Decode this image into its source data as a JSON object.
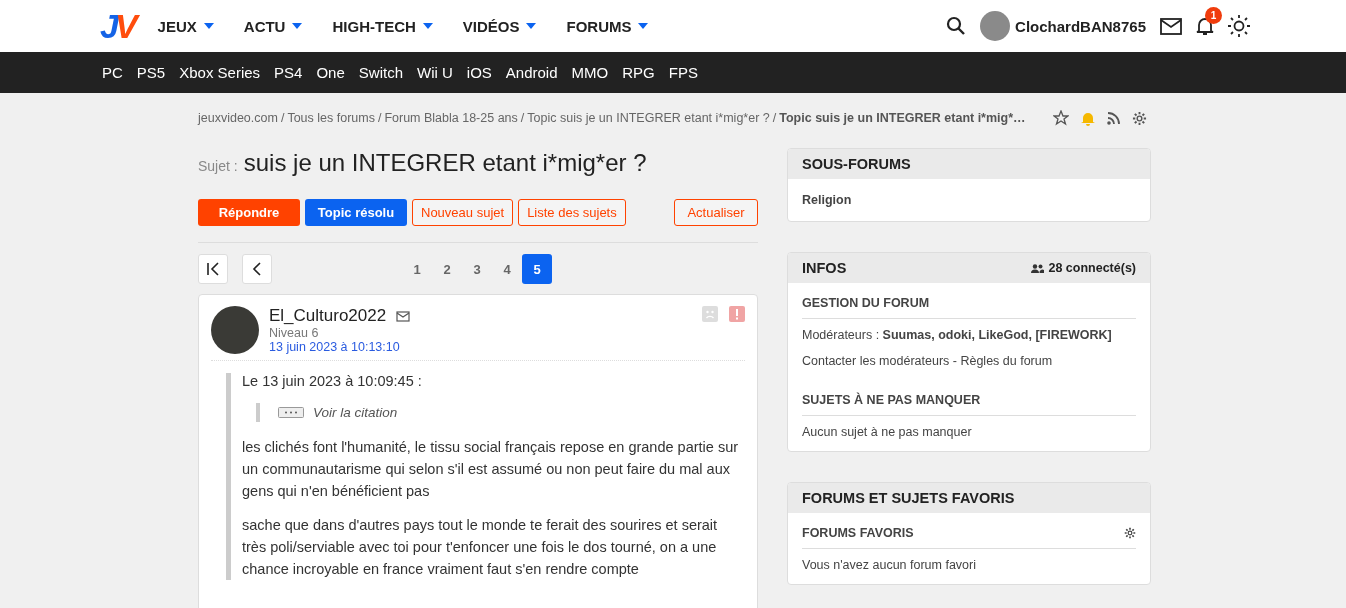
{
  "header": {
    "logo": [
      "J",
      "V"
    ],
    "menu": [
      {
        "label": "JEUX"
      },
      {
        "label": "ACTU"
      },
      {
        "label": "HIGH-TECH"
      },
      {
        "label": "VIDÉOS"
      },
      {
        "label": "FORUMS"
      }
    ],
    "username": "ClochardBAN8765",
    "notification_count": "1"
  },
  "platforms": [
    "PC",
    "PS5",
    "Xbox Series",
    "PS4",
    "One",
    "Switch",
    "Wii U",
    "iOS",
    "Android",
    "MMO",
    "RPG",
    "FPS"
  ],
  "breadcrumb_separator": "/",
  "breadcrumb": [
    {
      "label": "jeuxvideo.com",
      "current": false
    },
    {
      "label": "Tous les forums",
      "current": false
    },
    {
      "label": "Forum Blabla 18-25 ans",
      "current": false
    },
    {
      "label": "Topic suis je un INTEGRER etant i*mig*er ?",
      "current": false
    },
    {
      "label": "Topic suis je un INTEGRER etant i*mig*…",
      "current": true
    }
  ],
  "subject": {
    "prefix": "Sujet :",
    "title": "suis je un INTEGRER etant i*mig*er ?"
  },
  "actions": [
    {
      "label": "Répondre",
      "kind": "primary"
    },
    {
      "label": "Topic résolu",
      "kind": "info"
    },
    {
      "label": "Nouveau sujet",
      "kind": "outline"
    },
    {
      "label": "Liste des sujets",
      "kind": "outline"
    },
    {
      "label": "Actualiser",
      "kind": "outline"
    }
  ],
  "pages": [
    {
      "label": "1",
      "selected": false
    },
    {
      "label": "2",
      "selected": false
    },
    {
      "label": "3",
      "selected": false
    },
    {
      "label": "4",
      "selected": false
    },
    {
      "label": "5",
      "selected": true
    }
  ],
  "post": {
    "author": "El_Culturo2022",
    "level": "Niveau 6",
    "date": "13 juin 2023 à 10:13:10",
    "quote_header": "Le 13 juin 2023 à 10:09:45 :",
    "quote_toggle": "Voir la citation",
    "paragraphs": [
      "les clichés font l'humanité, le tissu social français repose en grande partie sur un communautarisme qui selon s'il est assumé ou non peut faire du mal aux gens qui n'en bénéficient pas",
      "sache que dans d'autres pays tout le monde te ferait des sourires et serait très poli/serviable avec toi pour t'enfoncer une fois le dos tourné, on a une chance incroyable en france vraiment faut s'en rendre compte"
    ]
  },
  "sidebar": {
    "subforums": {
      "title": "SOUS-FORUMS",
      "items": [
        "Religion"
      ]
    },
    "infos": {
      "title": "INFOS",
      "connected": "28 connecté(s)",
      "management_title": "GESTION DU FORUM",
      "moderators_label": "Modérateurs :",
      "moderators": "Suumas, odoki, LikeGod, [FIREWORK]",
      "contact": "Contacter les modérateurs",
      "separator": "-",
      "rules": "Règles du forum",
      "missed_title": "SUJETS À NE PAS MANQUER",
      "missed_empty": "Aucun sujet à ne pas manquer"
    },
    "favorites": {
      "title": "FORUMS ET SUJETS FAVORIS",
      "forums_title": "FORUMS FAVORIS",
      "forums_empty": "Vous n'avez aucun forum favori"
    }
  }
}
